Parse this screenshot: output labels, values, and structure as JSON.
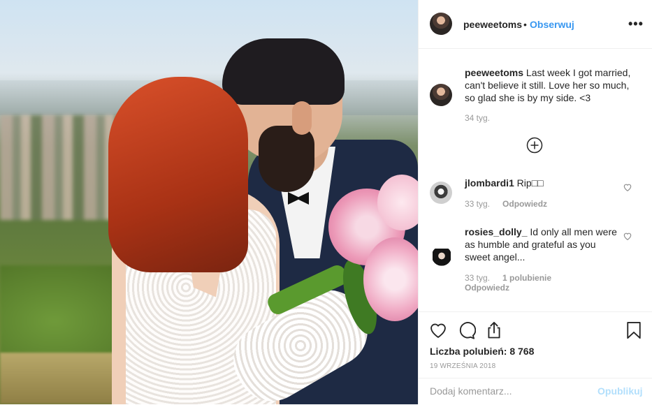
{
  "header": {
    "username": "peeweetoms",
    "dot": "•",
    "follow_label": "Obserwuj",
    "more_label": "•••"
  },
  "caption": {
    "username": "peeweetoms",
    "text": " Last week I got married, can't believe it still. Love her so much, so glad she is by my side. <3",
    "time": "34 tyg."
  },
  "comments": [
    {
      "username": "jlombardi1",
      "text": " Rip□□",
      "time": "33 tyg.",
      "reply": "Odpowiedz"
    },
    {
      "username": "rosies_dolly_",
      "text": " Id only all men were as humble and grateful as you sweet angel...",
      "time": "33 tyg.",
      "likes": "1 polubienie",
      "reply": "Odpowiedz"
    }
  ],
  "actions": {
    "likes_text": "Liczba polubień: 8 768",
    "date": "19 WRZEŚNIA 2018"
  },
  "add_comment": {
    "placeholder": "Dodaj komentarz...",
    "publish_label": "Opublikuj"
  },
  "icons": {
    "like": "heart-icon",
    "comment": "comment-icon",
    "share": "share-icon",
    "save": "bookmark-icon",
    "load_more": "plus-circle-icon",
    "more": "more-options-icon"
  },
  "colors": {
    "link": "#3897f0",
    "publish_disabled": "#b2dffc",
    "muted": "#999999"
  }
}
